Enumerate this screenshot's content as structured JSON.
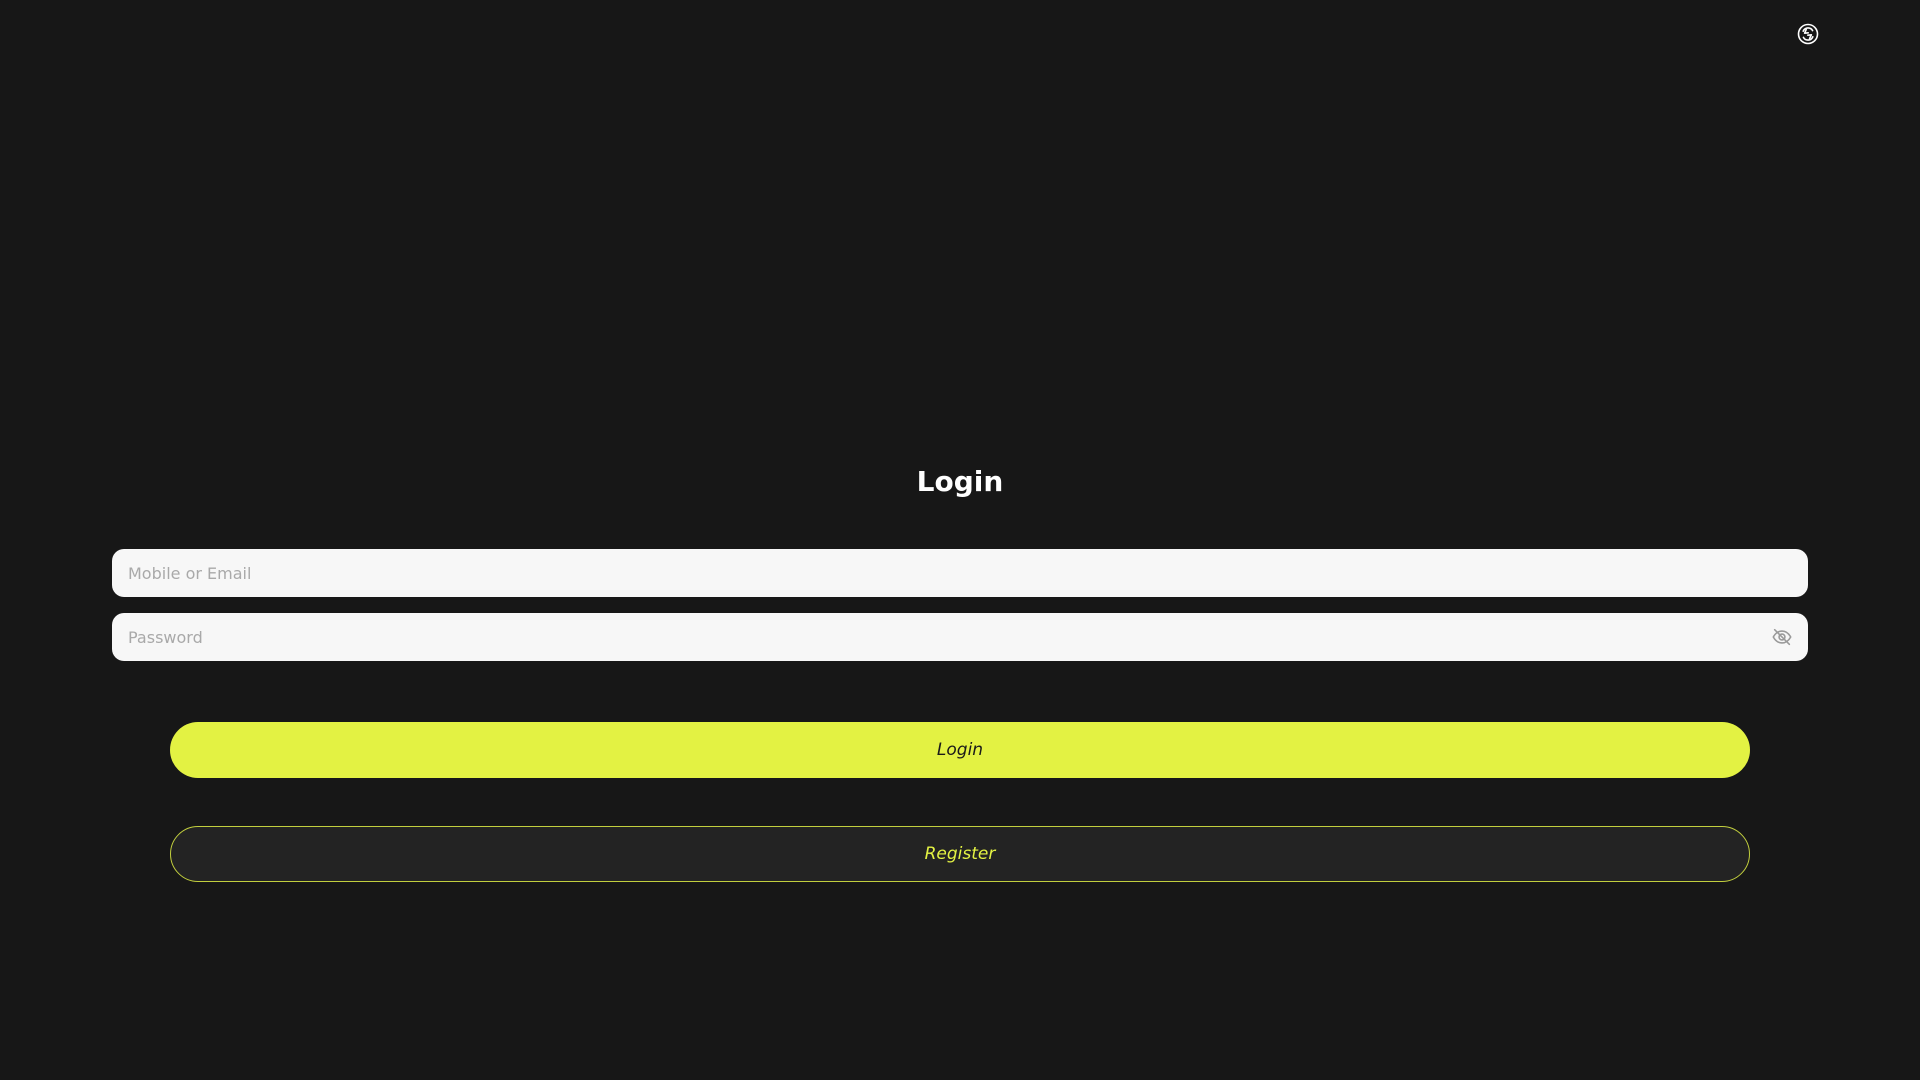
{
  "header": {
    "language_icon": "language-icon"
  },
  "login_form": {
    "title": "Login",
    "identifier_field": {
      "placeholder": "Mobile or Email",
      "value": ""
    },
    "password_field": {
      "placeholder": "Password",
      "value": "",
      "visibility_icon": "eye-off-icon"
    },
    "login_button_label": "Login",
    "register_button_label": "Register"
  },
  "colors": {
    "background": "#171717",
    "accent": "#e3f243",
    "input_background": "#f7f7f7",
    "register_background": "#232323"
  }
}
